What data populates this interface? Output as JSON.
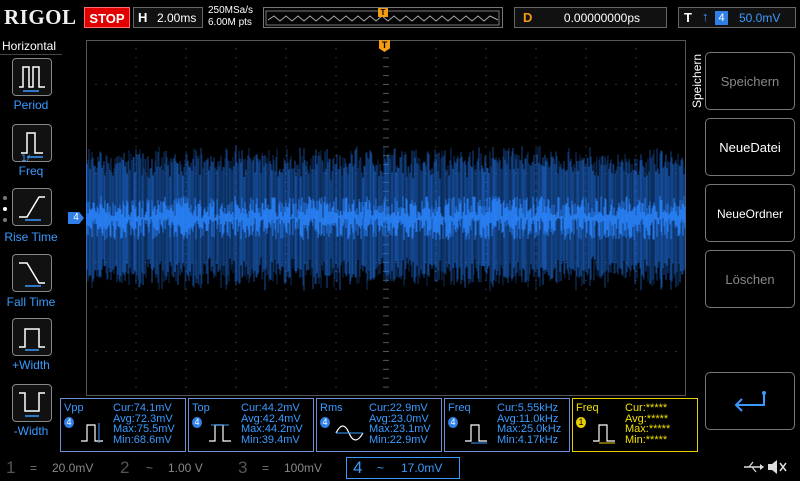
{
  "topbar": {
    "brand": "RIGOL",
    "run_state": "STOP",
    "horizontal_label": "H",
    "timebase": "2.00ms",
    "sample_rate": "250MSa/s",
    "memory_depth": "6.00M pts",
    "delay_label": "D",
    "delay_value": "0.00000000ps",
    "trigger_label": "T",
    "trigger_channel": "4",
    "trigger_level": "50.0mV"
  },
  "left_panel": {
    "title": "Horizontal",
    "items": [
      {
        "label": "Period",
        "icon": "period-icon"
      },
      {
        "label": "Freq",
        "icon": "frequency-icon"
      },
      {
        "label": "Rise Time",
        "icon": "rise-time-icon"
      },
      {
        "label": "Fall Time",
        "icon": "fall-time-icon"
      },
      {
        "label": "+Width",
        "icon": "positive-width-icon"
      },
      {
        "label": "-Width",
        "icon": "negative-width-icon"
      }
    ]
  },
  "waveform": {
    "channel_marker": "4",
    "trigger_marker": "T",
    "color": "#1e6fe0"
  },
  "right_panel": {
    "title": "Speichern",
    "buttons": [
      {
        "label": "Speichern",
        "enabled": false
      },
      {
        "label": "NeueDatei",
        "enabled": true
      },
      {
        "label": "NeueOrdner",
        "enabled": true
      },
      {
        "label": "Löschen",
        "enabled": false
      }
    ],
    "enter_icon": "return-arrow-icon"
  },
  "measurements": [
    {
      "name": "Vpp",
      "channel": "4",
      "values": "Cur:74.1mV\nAvg:72.3mV\nMax:75.5mV\nMin:68.6mV"
    },
    {
      "name": "Top",
      "channel": "4",
      "values": "Cur:44.2mV\nAvg:42.4mV\nMax:44.2mV\nMin:39.4mV"
    },
    {
      "name": "Rms",
      "channel": "4",
      "values": "Cur:22.9mV\nAvg:23.0mV\nMax:23.1mV\nMin:22.9mV"
    },
    {
      "name": "Freq",
      "channel": "4",
      "values": "Cur:5.55kHz\nAvg:11.0kHz\nMax:25.0kHz\nMin:4.17kHz"
    },
    {
      "name": "Freq",
      "channel": "1",
      "values": "Cur:*****\nAvg:*****\nMax:*****\nMin:*****"
    }
  ],
  "channels": [
    {
      "num": "1",
      "coupling": "=",
      "scale": "20.0mV",
      "color": "#555555"
    },
    {
      "num": "2",
      "coupling": "~",
      "scale": "1.00 V",
      "color": "#555555"
    },
    {
      "num": "3",
      "coupling": "=",
      "scale": "100mV",
      "color": "#555555"
    },
    {
      "num": "4",
      "coupling": "~",
      "scale": "17.0mV",
      "color": "#3a9bff"
    }
  ],
  "status": {
    "usb_icon": "usb-icon",
    "sound_icon": "speaker-muted-icon"
  }
}
